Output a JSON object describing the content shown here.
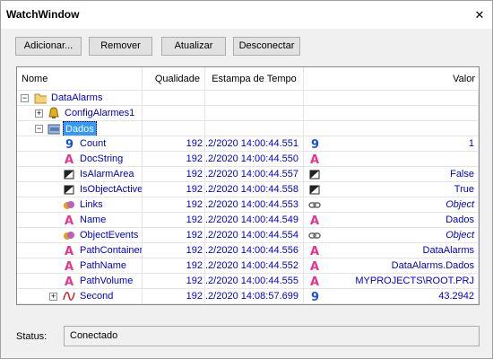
{
  "window": {
    "title": "WatchWindow",
    "close_glyph": "✕"
  },
  "toolbar": {
    "add_label": "Adicionar...",
    "remove_label": "Remover",
    "update_label": "Atualizar",
    "disconnect_label": "Desconectar"
  },
  "grid": {
    "columns": {
      "name": "Nome",
      "quality": "Qualidade",
      "timestamp": "Estampa de Tempo",
      "value": "Valor"
    },
    "tree": {
      "root_label": "DataAlarms",
      "config_label": "ConfigAlarmes1",
      "dados_label": "Dados"
    },
    "rows": [
      {
        "name": "Count",
        "quality": "192",
        "timestamp": ".2/2020 14:00:44.551",
        "value": "1",
        "value_icon": "number-9-icon",
        "name_icon": "number-9-icon"
      },
      {
        "name": "DocString",
        "quality": "192",
        "timestamp": ".2/2020 14:00:44.550",
        "value": "",
        "value_icon": "string-a-icon",
        "name_icon": "string-a-icon"
      },
      {
        "name": "IsAlarmArea",
        "quality": "192",
        "timestamp": ".2/2020 14:00:44.557",
        "value": "False",
        "value_icon": "boolean-icon",
        "name_icon": "boolean-icon"
      },
      {
        "name": "IsObjectActive",
        "quality": "192",
        "timestamp": ".2/2020 14:00:44.558",
        "value": "True",
        "value_icon": "boolean-icon",
        "name_icon": "boolean-icon"
      },
      {
        "name": "Links",
        "quality": "192",
        "timestamp": ".2/2020 14:00:44.553",
        "value": "Object",
        "value_icon": "link-icon",
        "name_icon": "object-icon",
        "italic": true
      },
      {
        "name": "Name",
        "quality": "192",
        "timestamp": ".2/2020 14:00:44.549",
        "value": "Dados",
        "value_icon": "string-a-icon",
        "name_icon": "string-a-icon"
      },
      {
        "name": "ObjectEvents",
        "quality": "192",
        "timestamp": ".2/2020 14:00:44.554",
        "value": "Object",
        "value_icon": "link-icon",
        "name_icon": "object-icon",
        "italic": true
      },
      {
        "name": "PathContainer",
        "quality": "192",
        "timestamp": ".2/2020 14:00:44.556",
        "value": "DataAlarms",
        "value_icon": "string-a-icon",
        "name_icon": "string-a-icon"
      },
      {
        "name": "PathName",
        "quality": "192",
        "timestamp": ".2/2020 14:00:44.552",
        "value": "DataAlarms.Dados",
        "value_icon": "string-a-icon",
        "name_icon": "string-a-icon"
      },
      {
        "name": "PathVolume",
        "quality": "192",
        "timestamp": ".2/2020 14:00:44.555",
        "value": "MYPROJECTS\\ROOT.PRJ",
        "value_icon": "string-a-icon",
        "name_icon": "string-a-icon"
      },
      {
        "name": "Second",
        "quality": "192",
        "timestamp": ".2/2020 14:08:57.699",
        "value": "43.2942",
        "value_icon": "number-9-icon",
        "name_icon": "trend-curve-icon"
      }
    ]
  },
  "status": {
    "label": "Status:",
    "value": "Conectado"
  },
  "colors": {
    "value_text": "#0000cc",
    "selection": "#3399ff",
    "string_icon": "#e8348a",
    "number_icon": "#1c4fd8"
  }
}
